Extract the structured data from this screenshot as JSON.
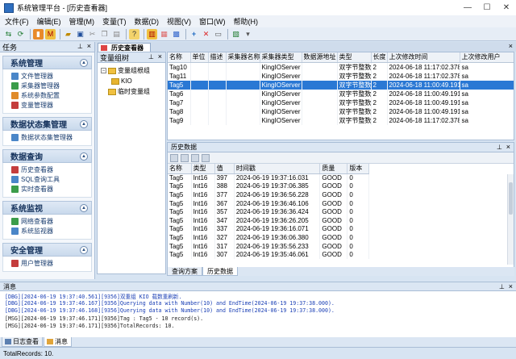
{
  "window": {
    "title": "系统管理平台 - [历史查看器]"
  },
  "menu": [
    "文件(F)",
    "编辑(E)",
    "管理(M)",
    "变量(T)",
    "数据(D)",
    "视图(V)",
    "窗口(W)",
    "帮助(H)"
  ],
  "left_panel": {
    "title": "任务",
    "groups": [
      {
        "title": "系统管理",
        "items": [
          "文件管理器",
          "采集器管理器",
          "系统参数配置",
          "变量管理器"
        ]
      },
      {
        "title": "数据状态集管理",
        "items": [
          "数据状态集管理器"
        ]
      },
      {
        "title": "数据查询",
        "items": [
          "历史查看器",
          "SQL查询工具",
          "实时查看器"
        ]
      },
      {
        "title": "系统监视",
        "items": [
          "网络查看器",
          "系统监视器"
        ]
      },
      {
        "title": "安全管理",
        "items": [
          "用户管理器"
        ]
      }
    ]
  },
  "doc_tab": {
    "label": "历史查看器"
  },
  "tree": {
    "title": "变量组树",
    "items": [
      {
        "label": "变量组根组",
        "level": 0,
        "expander": "−"
      },
      {
        "label": "KIO",
        "level": 1,
        "expander": ""
      },
      {
        "label": "临时变量组",
        "level": 0,
        "expander": ""
      }
    ]
  },
  "var_table": {
    "columns": [
      "名称",
      "单位",
      "描述",
      "采集器名称",
      "采集器类型",
      "数据源地址",
      "类型",
      "长度",
      "上次修改时间",
      "上次修改用户"
    ],
    "rows": [
      [
        "Tag10",
        "",
        "",
        "",
        "KingIOServer",
        "",
        "双字节整数",
        "2",
        "2024-06-18 11:17:02.378",
        "sa"
      ],
      [
        "Tag11",
        "",
        "",
        "",
        "KingIOServer",
        "",
        "双字节整数",
        "2",
        "2024-06-18 11:17:02.378",
        "sa"
      ],
      [
        "Tag5",
        "",
        "",
        "",
        "KingIOServer",
        "",
        "双字节整数",
        "2",
        "2024-06-18 11:00:49.191",
        "sa"
      ],
      [
        "Tag6",
        "",
        "",
        "",
        "KingIOServer",
        "",
        "双字节整数",
        "2",
        "2024-06-18 11:00:49.191",
        "sa"
      ],
      [
        "Tag7",
        "",
        "",
        "",
        "KingIOServer",
        "",
        "双字节整数",
        "2",
        "2024-06-18 11:00:49.191",
        "sa"
      ],
      [
        "Tag8",
        "",
        "",
        "",
        "KingIOServer",
        "",
        "双字节整数",
        "2",
        "2024-06-18 11:00:49.191",
        "sa"
      ],
      [
        "Tag9",
        "",
        "",
        "",
        "KingIOServer",
        "",
        "双字节整数",
        "2",
        "2024-06-18 11:17:02.378",
        "sa"
      ]
    ],
    "selected_row": 2
  },
  "history": {
    "title": "历史数据",
    "columns": [
      "名称",
      "类型",
      "值",
      "时间戳",
      "质量",
      "版本"
    ],
    "rows": [
      [
        "Tag5",
        "Int16",
        "397",
        "2024-06-19 19:37:16.031",
        "GOOD",
        "0"
      ],
      [
        "Tag5",
        "Int16",
        "388",
        "2024-06-19 19:37:06.385",
        "GOOD",
        "0"
      ],
      [
        "Tag5",
        "Int16",
        "377",
        "2024-06-19 19:36:56.228",
        "GOOD",
        "0"
      ],
      [
        "Tag5",
        "Int16",
        "367",
        "2024-06-19 19:36:46.106",
        "GOOD",
        "0"
      ],
      [
        "Tag5",
        "Int16",
        "357",
        "2024-06-19 19:36:36.424",
        "GOOD",
        "0"
      ],
      [
        "Tag5",
        "Int16",
        "347",
        "2024-06-19 19:36:26.205",
        "GOOD",
        "0"
      ],
      [
        "Tag5",
        "Int16",
        "337",
        "2024-06-19 19:36:16.071",
        "GOOD",
        "0"
      ],
      [
        "Tag5",
        "Int16",
        "327",
        "2024-06-19 19:36:06.380",
        "GOOD",
        "0"
      ],
      [
        "Tag5",
        "Int16",
        "317",
        "2024-06-19 19:35:56.233",
        "GOOD",
        "0"
      ],
      [
        "Tag5",
        "Int16",
        "307",
        "2024-06-19 19:35:46.061",
        "GOOD",
        "0"
      ]
    ]
  },
  "sub_tabs": [
    "查询方案",
    "历史数据"
  ],
  "messages": {
    "title": "消息",
    "lines": [
      {
        "level": "dbg",
        "text": "[DBG][2024-06-19 19:37:40.561][9356]双重组 KIO 载数重刷新."
      },
      {
        "level": "dbg",
        "text": "[DBG][2024-06-19 19:37:46.167][9356]Querying data with Number(10) and EndTime(2024-06-19 19:37:38.000)."
      },
      {
        "level": "dbg",
        "text": "[DBG][2024-06-19 19:37:46.168][9356]Querying data with Number(10) and EndTime(2024-06-19 19:37:38.000)."
      },
      {
        "level": "msg",
        "text": "[MSG][2024-06-19 19:37:46.171][9356]Tag : Tag5 - 10 record(s)."
      },
      {
        "level": "msg",
        "text": "[MSG][2024-06-19 19:37:46.171][9356]TotalRecords: 10."
      }
    ]
  },
  "bottom_tabs": [
    "日志查看",
    "消息"
  ],
  "status": {
    "text": "TotalRecords: 10."
  }
}
